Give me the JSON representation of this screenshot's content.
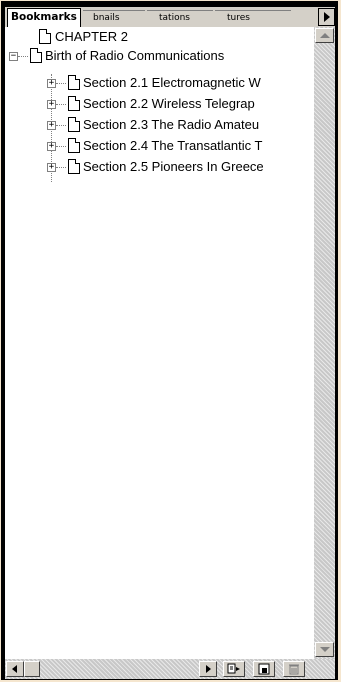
{
  "tabs": [
    {
      "label": "Bookmarks",
      "active": true
    },
    {
      "label": "bnails",
      "active": false
    },
    {
      "label": "tations",
      "active": false
    },
    {
      "label": "tures",
      "active": false
    }
  ],
  "tree": {
    "chapter": "CHAPTER 2",
    "root": {
      "label": "Birth of Radio Communications",
      "expanded": true,
      "children": [
        {
          "label": "Section 2.1 Electromagnetic W",
          "expanded": false
        },
        {
          "label": "Section 2.2 Wireless Telegrap",
          "expanded": false
        },
        {
          "label": "Section 2.3 The Radio Amateu",
          "expanded": false
        },
        {
          "label": "Section 2.4 The Transatlantic T",
          "expanded": false
        },
        {
          "label": "Section 2.5 Pioneers In Greece",
          "expanded": false
        }
      ]
    }
  },
  "icons": {
    "expand": "plus-box",
    "collapse": "minus-box",
    "page": "page-icon"
  },
  "colors": {
    "background": "#f5e6cf",
    "frame": "#000000",
    "chrome": "#d4d0c8"
  }
}
